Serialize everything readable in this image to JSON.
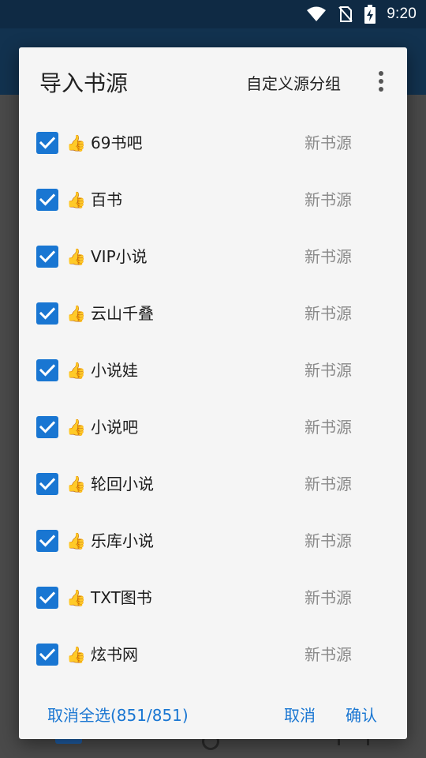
{
  "status_bar": {
    "time": "9:20",
    "icons": [
      "wifi-icon",
      "no-sim-icon",
      "battery-charging-icon"
    ]
  },
  "dialog": {
    "title": "导入书源",
    "group_button": "自定义源分组",
    "more_icon": "more-vert-icon",
    "items": [
      {
        "name": "69书吧",
        "status": "新书源",
        "checked": true
      },
      {
        "name": "百书",
        "status": "新书源",
        "checked": true
      },
      {
        "name": "VIP小说",
        "status": "新书源",
        "checked": true
      },
      {
        "name": "云山千叠",
        "status": "新书源",
        "checked": true
      },
      {
        "name": "小说娃",
        "status": "新书源",
        "checked": true
      },
      {
        "name": "小说吧",
        "status": "新书源",
        "checked": true
      },
      {
        "name": "轮回小说",
        "status": "新书源",
        "checked": true
      },
      {
        "name": "乐库小说",
        "status": "新书源",
        "checked": true
      },
      {
        "name": "TXT图书",
        "status": "新书源",
        "checked": true
      },
      {
        "name": "炫书网",
        "status": "新书源",
        "checked": true
      }
    ],
    "footer": {
      "select_all": "取消全选(851/851)",
      "cancel": "取消",
      "confirm": "确认"
    }
  },
  "colors": {
    "accent": "#1976d2",
    "status_bar": "#0f2a44",
    "app_bar": "#12324f",
    "scrim": "#4a4a4a",
    "dialog_bg": "#f5f5f5",
    "thumb": "#f4a300"
  }
}
